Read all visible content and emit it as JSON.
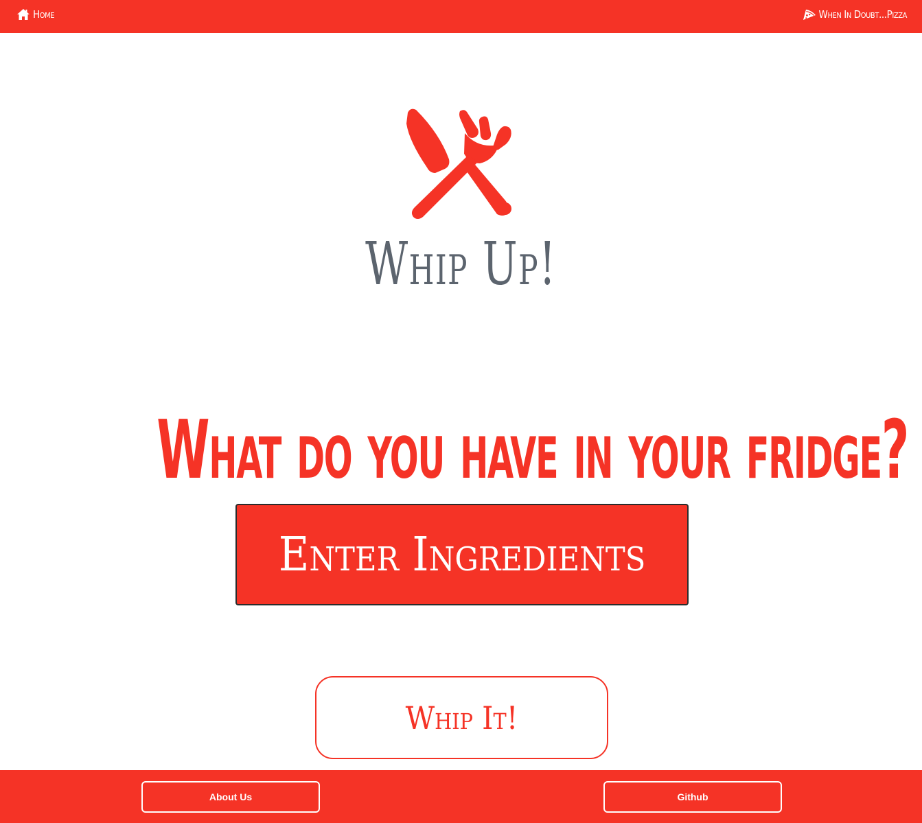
{
  "colors": {
    "brand_red": "#f53326",
    "title_gray": "#5c646e",
    "white": "#ffffff"
  },
  "nav": {
    "home": {
      "label": "Home",
      "icon": "home-icon"
    },
    "pizza": {
      "label": "When In Doubt...Pizza",
      "icon": "pizza-slice-icon"
    }
  },
  "logo": {
    "icon": "knife-fork-icon",
    "title": "Whip Up!"
  },
  "main": {
    "headline": "What do you have in your fridge?",
    "ingredients_placeholder": "Enter Ingredients",
    "submit_label": "Whip It!"
  },
  "footer": {
    "about_label": "About Us",
    "github_label": "Github"
  }
}
